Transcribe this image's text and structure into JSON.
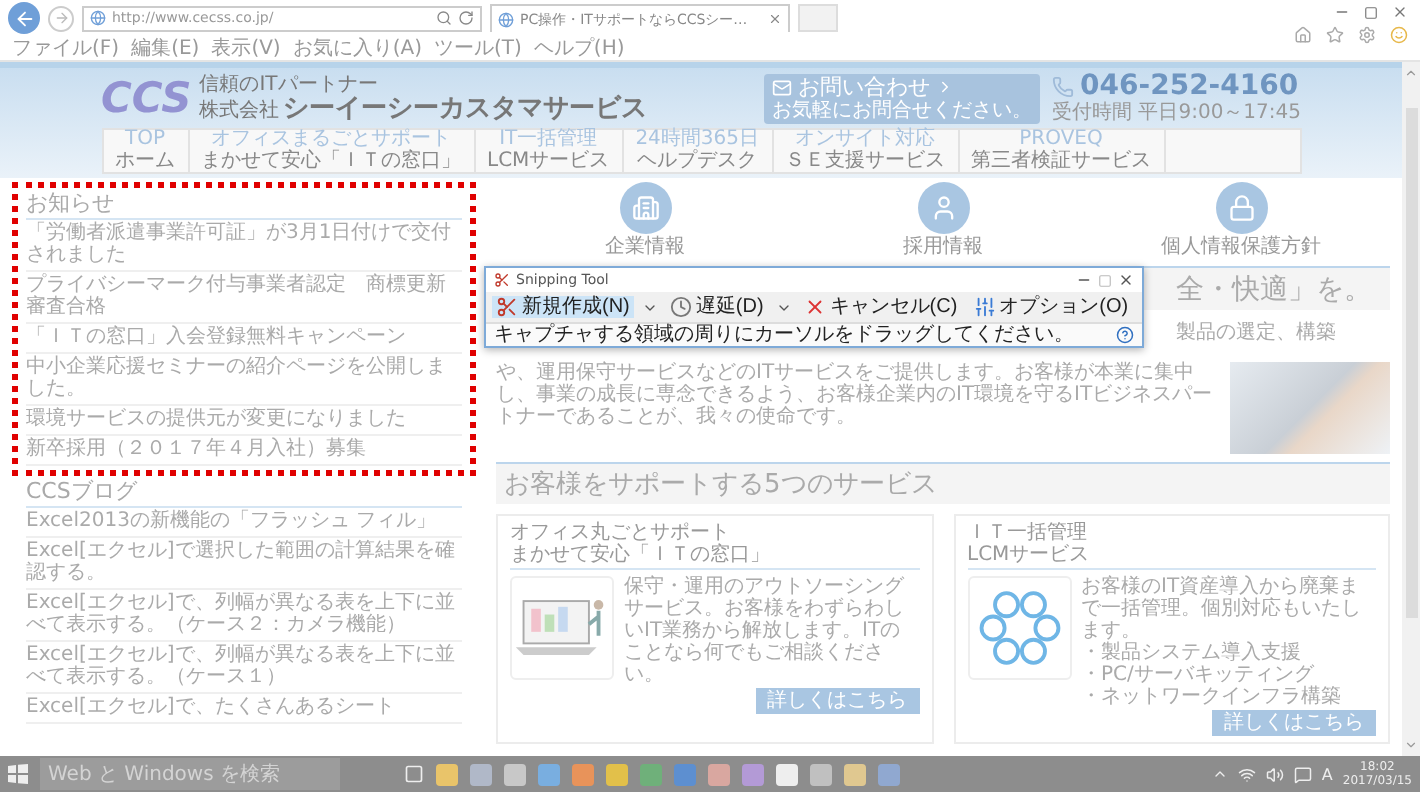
{
  "browser": {
    "address": "http://www.cecss.co.jp/",
    "tab": "PC操作・ITサポートならCCSシー…",
    "menu": [
      "ファイル(F)",
      "編集(E)",
      "表示(V)",
      "お気に入り(A)",
      "ツール(T)",
      "ヘルプ(H)"
    ]
  },
  "header": {
    "logo": "CCS",
    "tagline": "信頼のITパートナー",
    "company_prefix": "株式会社",
    "company": "シーイーシーカスタマサービス",
    "contact": {
      "label": "お問い合わせ",
      "sub": "お気軽にお問合せください。"
    },
    "phone": "046-252-4160",
    "hours": "受付時間 平日9:00～17:45"
  },
  "nav": [
    {
      "sub": "TOP",
      "label": "ホーム"
    },
    {
      "sub": "オフィスまるごとサポート",
      "label": "まかせて安心「ＩＴの窓口」"
    },
    {
      "sub": "IT一括管理",
      "label": "LCMサービス"
    },
    {
      "sub": "24時間365日",
      "label": "ヘルプデスク"
    },
    {
      "sub": "オンサイト対応",
      "label": "ＳＥ支援サービス"
    },
    {
      "sub": "PROVEQ",
      "label": "第三者検証サービス"
    }
  ],
  "notices": {
    "title": "お知らせ",
    "items": [
      "「労働者派遣事業許可証」が3月1日付けで交付されました",
      "プライバシーマーク付与事業者認定　商標更新審査合格",
      "「ＩＴの窓口」入会登録無料キャンペーン",
      "中小企業応援セミナーの紹介ページを公開しました。",
      "環境サービスの提供元が変更になりました",
      "新卒採用（２０１７年４月入社）募集"
    ]
  },
  "blog": {
    "title": "CCSブログ",
    "items": [
      "Excel2013の新機能の「フラッシュ フィル」",
      "Excel[エクセル]で選択した範囲の計算結果を確認する。",
      "Excel[エクセル]で、列幅が異なる表を上下に並べて表示する。（ケース２：カメラ機能）",
      "Excel[エクセル]で、列幅が異なる表を上下に並べて表示する。（ケース１）",
      "Excel[エクセル]で、たくさんあるシート"
    ]
  },
  "links": [
    {
      "kind": "building",
      "label": "企業情報"
    },
    {
      "kind": "person",
      "label": "採用情報"
    },
    {
      "kind": "lock",
      "label": "個人情報保護方針"
    }
  ],
  "intro": {
    "heading": "全・快適」を。",
    "first_line": "製品の選定、構築",
    "text": "や、運用保守サービスなどのITサービスをご提供します。お客様が本業に集中し、事業の成長に専念できるよう、お客様企業内のIT環境を守るITビジネスパートナーであることが、我々の使命です。"
  },
  "services": {
    "heading": "お客様をサポートする5つのサービス",
    "cards": [
      {
        "kind": "laptop",
        "title": [
          "オフィス丸ごとサポート",
          "まかせて安心「ＩＴの窓口」"
        ],
        "text": "保守・運用のアウトソーシングサービス。お客様をわずらわしいIT業務から解放します。ITのことなら何でもご相談ください。",
        "button": "詳しくはこちら"
      },
      {
        "kind": "cycle",
        "title": [
          "ＩＴ一括管理",
          "LCMサービス"
        ],
        "text": "お客様のIT資産導入から廃棄まで一括管理。個別対応もいたします。",
        "bullets": [
          "・製品システム導入支援",
          "・PC/サーバキッティング",
          "・ネットワークインフラ構築"
        ],
        "button": "詳しくはこちら"
      }
    ]
  },
  "snipping_tool": {
    "title": "Snipping Tool",
    "buttons": [
      {
        "kind": "new",
        "label": "新規作成(N)"
      },
      {
        "kind": "delay",
        "label": "遅延(D)"
      },
      {
        "kind": "cancel",
        "label": "キャンセル(C)"
      },
      {
        "kind": "options",
        "label": "オプション(O)"
      }
    ],
    "message": "キャプチャする領域の周りにカーソルをドラッグしてください。"
  },
  "taskbar": {
    "search_placeholder": "Web と Windows を検索",
    "ime": "A",
    "time": "18:02",
    "date": "2017/03/15"
  }
}
